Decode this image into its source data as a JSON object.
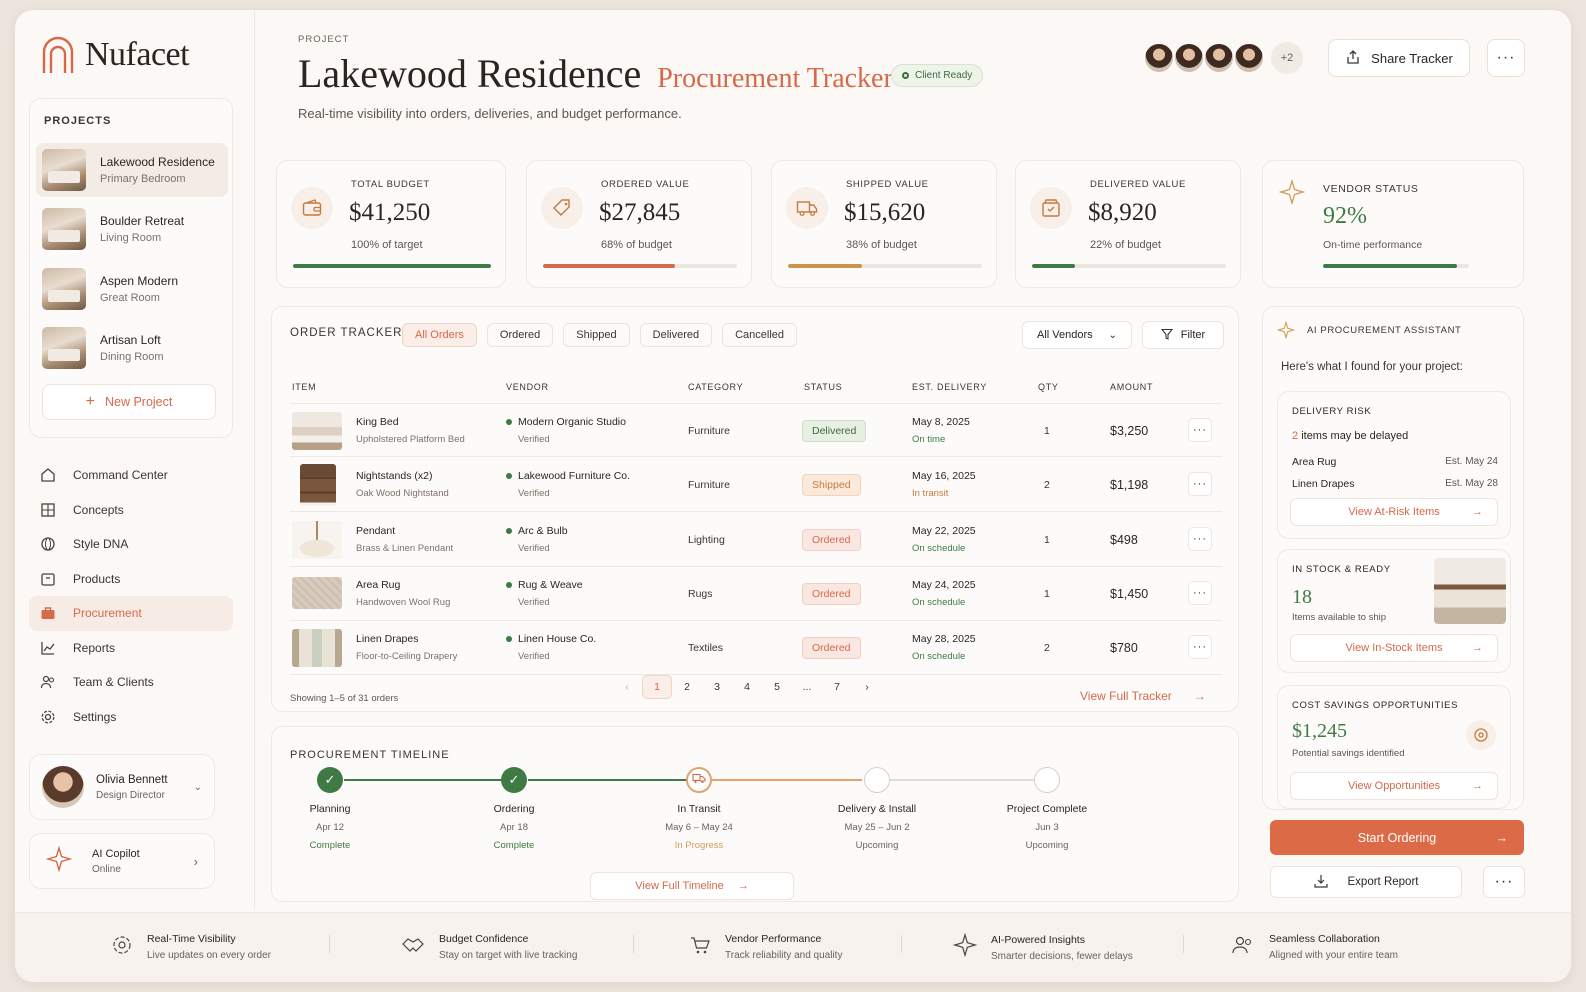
{
  "brand": {
    "name": "Nufacet"
  },
  "sidebar": {
    "projects_label": "PROJECTS",
    "projects": [
      {
        "name": "Lakewood Residence",
        "room": "Primary Bedroom"
      },
      {
        "name": "Boulder Retreat",
        "room": "Living Room"
      },
      {
        "name": "Aspen Modern",
        "room": "Great Room"
      },
      {
        "name": "Artisan Loft",
        "room": "Dining Room"
      }
    ],
    "new_project": "New Project",
    "nav": [
      {
        "label": "Command Center",
        "icon": "home-icon"
      },
      {
        "label": "Concepts",
        "icon": "grid-icon"
      },
      {
        "label": "Style DNA",
        "icon": "globe-icon"
      },
      {
        "label": "Products",
        "icon": "box-icon"
      },
      {
        "label": "Procurement",
        "icon": "briefcase-icon"
      },
      {
        "label": "Reports",
        "icon": "chart-icon"
      },
      {
        "label": "Team & Clients",
        "icon": "users-icon"
      },
      {
        "label": "Settings",
        "icon": "gear-icon"
      }
    ],
    "user": {
      "name": "Olivia Bennett",
      "role": "Design Director"
    },
    "copilot": {
      "title": "AI Copilot",
      "status": "Online"
    }
  },
  "header": {
    "eyebrow": "PROJECT",
    "title": "Lakewood Residence",
    "title_accent": "Procurement Tracker",
    "badge": "Client Ready",
    "subtitle": "Real-time visibility into orders, deliveries, and budget performance.",
    "avatar_more": "+2",
    "share": "Share Tracker",
    "more": "···"
  },
  "kpis": [
    {
      "label": "TOTAL BUDGET",
      "value": "$41,250",
      "sub": "100% of target",
      "progress": 1.0,
      "color": "#3f7a45",
      "icon": "wallet-icon"
    },
    {
      "label": "ORDERED VALUE",
      "value": "$27,845",
      "sub": "68% of budget",
      "progress": 0.68,
      "color": "#d5694a",
      "icon": "tag-icon"
    },
    {
      "label": "SHIPPED VALUE",
      "value": "$15,620",
      "sub": "38% of budget",
      "progress": 0.38,
      "color": "#c9954f",
      "icon": "truck-icon"
    },
    {
      "label": "DELIVERED VALUE",
      "value": "$8,920",
      "sub": "22% of budget",
      "progress": 0.22,
      "color": "#3f7a45",
      "icon": "box-check-icon"
    }
  ],
  "vendor_status": {
    "label": "VENDOR STATUS",
    "value": "92%",
    "sub": "On-time performance",
    "progress": 0.92,
    "color": "#3f7a45"
  },
  "tracker": {
    "title": "ORDER TRACKER",
    "tabs": [
      "All Orders",
      "Ordered",
      "Shipped",
      "Delivered",
      "Cancelled"
    ],
    "vendor_select": "All Vendors",
    "filter": "Filter",
    "columns": [
      "ITEM",
      "VENDOR",
      "CATEGORY",
      "STATUS",
      "EST. DELIVERY",
      "QTY",
      "AMOUNT"
    ],
    "rows": [
      {
        "name": "King Bed",
        "desc": "Upholstered Platform Bed",
        "vendor": "Modern Organic Studio",
        "verified": "Verified",
        "category": "Furniture",
        "status": "Delivered",
        "date": "May 8, 2025",
        "eta": "On time",
        "qty": "1",
        "amount": "$3,250"
      },
      {
        "name": "Nightstands (x2)",
        "desc": "Oak Wood Nightstand",
        "vendor": "Lakewood Furniture Co.",
        "verified": "Verified",
        "category": "Furniture",
        "status": "Shipped",
        "date": "May 16, 2025",
        "eta": "In transit",
        "qty": "2",
        "amount": "$1,198"
      },
      {
        "name": "Pendant",
        "desc": "Brass & Linen Pendant",
        "vendor": "Arc & Bulb",
        "verified": "Verified",
        "category": "Lighting",
        "status": "Ordered",
        "date": "May 22, 2025",
        "eta": "On schedule",
        "qty": "1",
        "amount": "$498"
      },
      {
        "name": "Area Rug",
        "desc": "Handwoven Wool Rug",
        "vendor": "Rug & Weave",
        "verified": "Verified",
        "category": "Rugs",
        "status": "Ordered",
        "date": "May 24, 2025",
        "eta": "On schedule",
        "qty": "1",
        "amount": "$1,450"
      },
      {
        "name": "Linen Drapes",
        "desc": "Floor-to-Ceiling Drapery",
        "vendor": "Linen House Co.",
        "verified": "Verified",
        "category": "Textiles",
        "status": "Ordered",
        "date": "May 28, 2025",
        "eta": "On schedule",
        "qty": "2",
        "amount": "$780"
      }
    ],
    "showing": "Showing 1–5 of 31 orders",
    "pages": [
      "1",
      "2",
      "3",
      "4",
      "5",
      "...",
      "7"
    ],
    "view_full": "View Full Tracker"
  },
  "timeline": {
    "title": "PROCUREMENT TIMELINE",
    "steps": [
      {
        "title": "Planning",
        "date": "Apr 12",
        "status": "Complete",
        "state": "done"
      },
      {
        "title": "Ordering",
        "date": "Apr 18",
        "status": "Complete",
        "state": "done"
      },
      {
        "title": "In Transit",
        "date": "May 6 – May 24",
        "status": "In Progress",
        "state": "progress"
      },
      {
        "title": "Delivery & Install",
        "date": "May 25 – Jun 2",
        "status": "Upcoming",
        "state": "upcoming"
      },
      {
        "title": "Project Complete",
        "date": "Jun 3",
        "status": "Upcoming",
        "state": "upcoming"
      }
    ],
    "view_full": "View Full Timeline"
  },
  "assistant": {
    "title": "AI PROCUREMENT ASSISTANT",
    "intro": "Here's what I found for your project:",
    "risk": {
      "label": "DELIVERY RISK",
      "count": "2",
      "count_text": "items may be delayed",
      "items": [
        {
          "name": "Area Rug",
          "eta": "Est. May 24"
        },
        {
          "name": "Linen Drapes",
          "eta": "Est. May 28"
        }
      ],
      "link": "View At-Risk Items"
    },
    "stock": {
      "label": "IN STOCK & READY",
      "value": "18",
      "sub": "Items available to ship",
      "link": "View In-Stock Items"
    },
    "savings": {
      "label": "COST SAVINGS OPPORTUNITIES",
      "value": "$1,245",
      "sub": "Potential savings identified",
      "link": "View Opportunities"
    },
    "start": "Start Ordering",
    "export": "Export Report"
  },
  "footer": [
    {
      "title": "Real-Time Visibility",
      "sub": "Live updates on every order"
    },
    {
      "title": "Budget Confidence",
      "sub": "Stay on target with live tracking"
    },
    {
      "title": "Vendor Performance",
      "sub": "Track reliability and quality"
    },
    {
      "title": "AI-Powered Insights",
      "sub": "Smarter decisions, fewer delays"
    },
    {
      "title": "Seamless Collaboration",
      "sub": "Aligned with your entire team"
    }
  ]
}
